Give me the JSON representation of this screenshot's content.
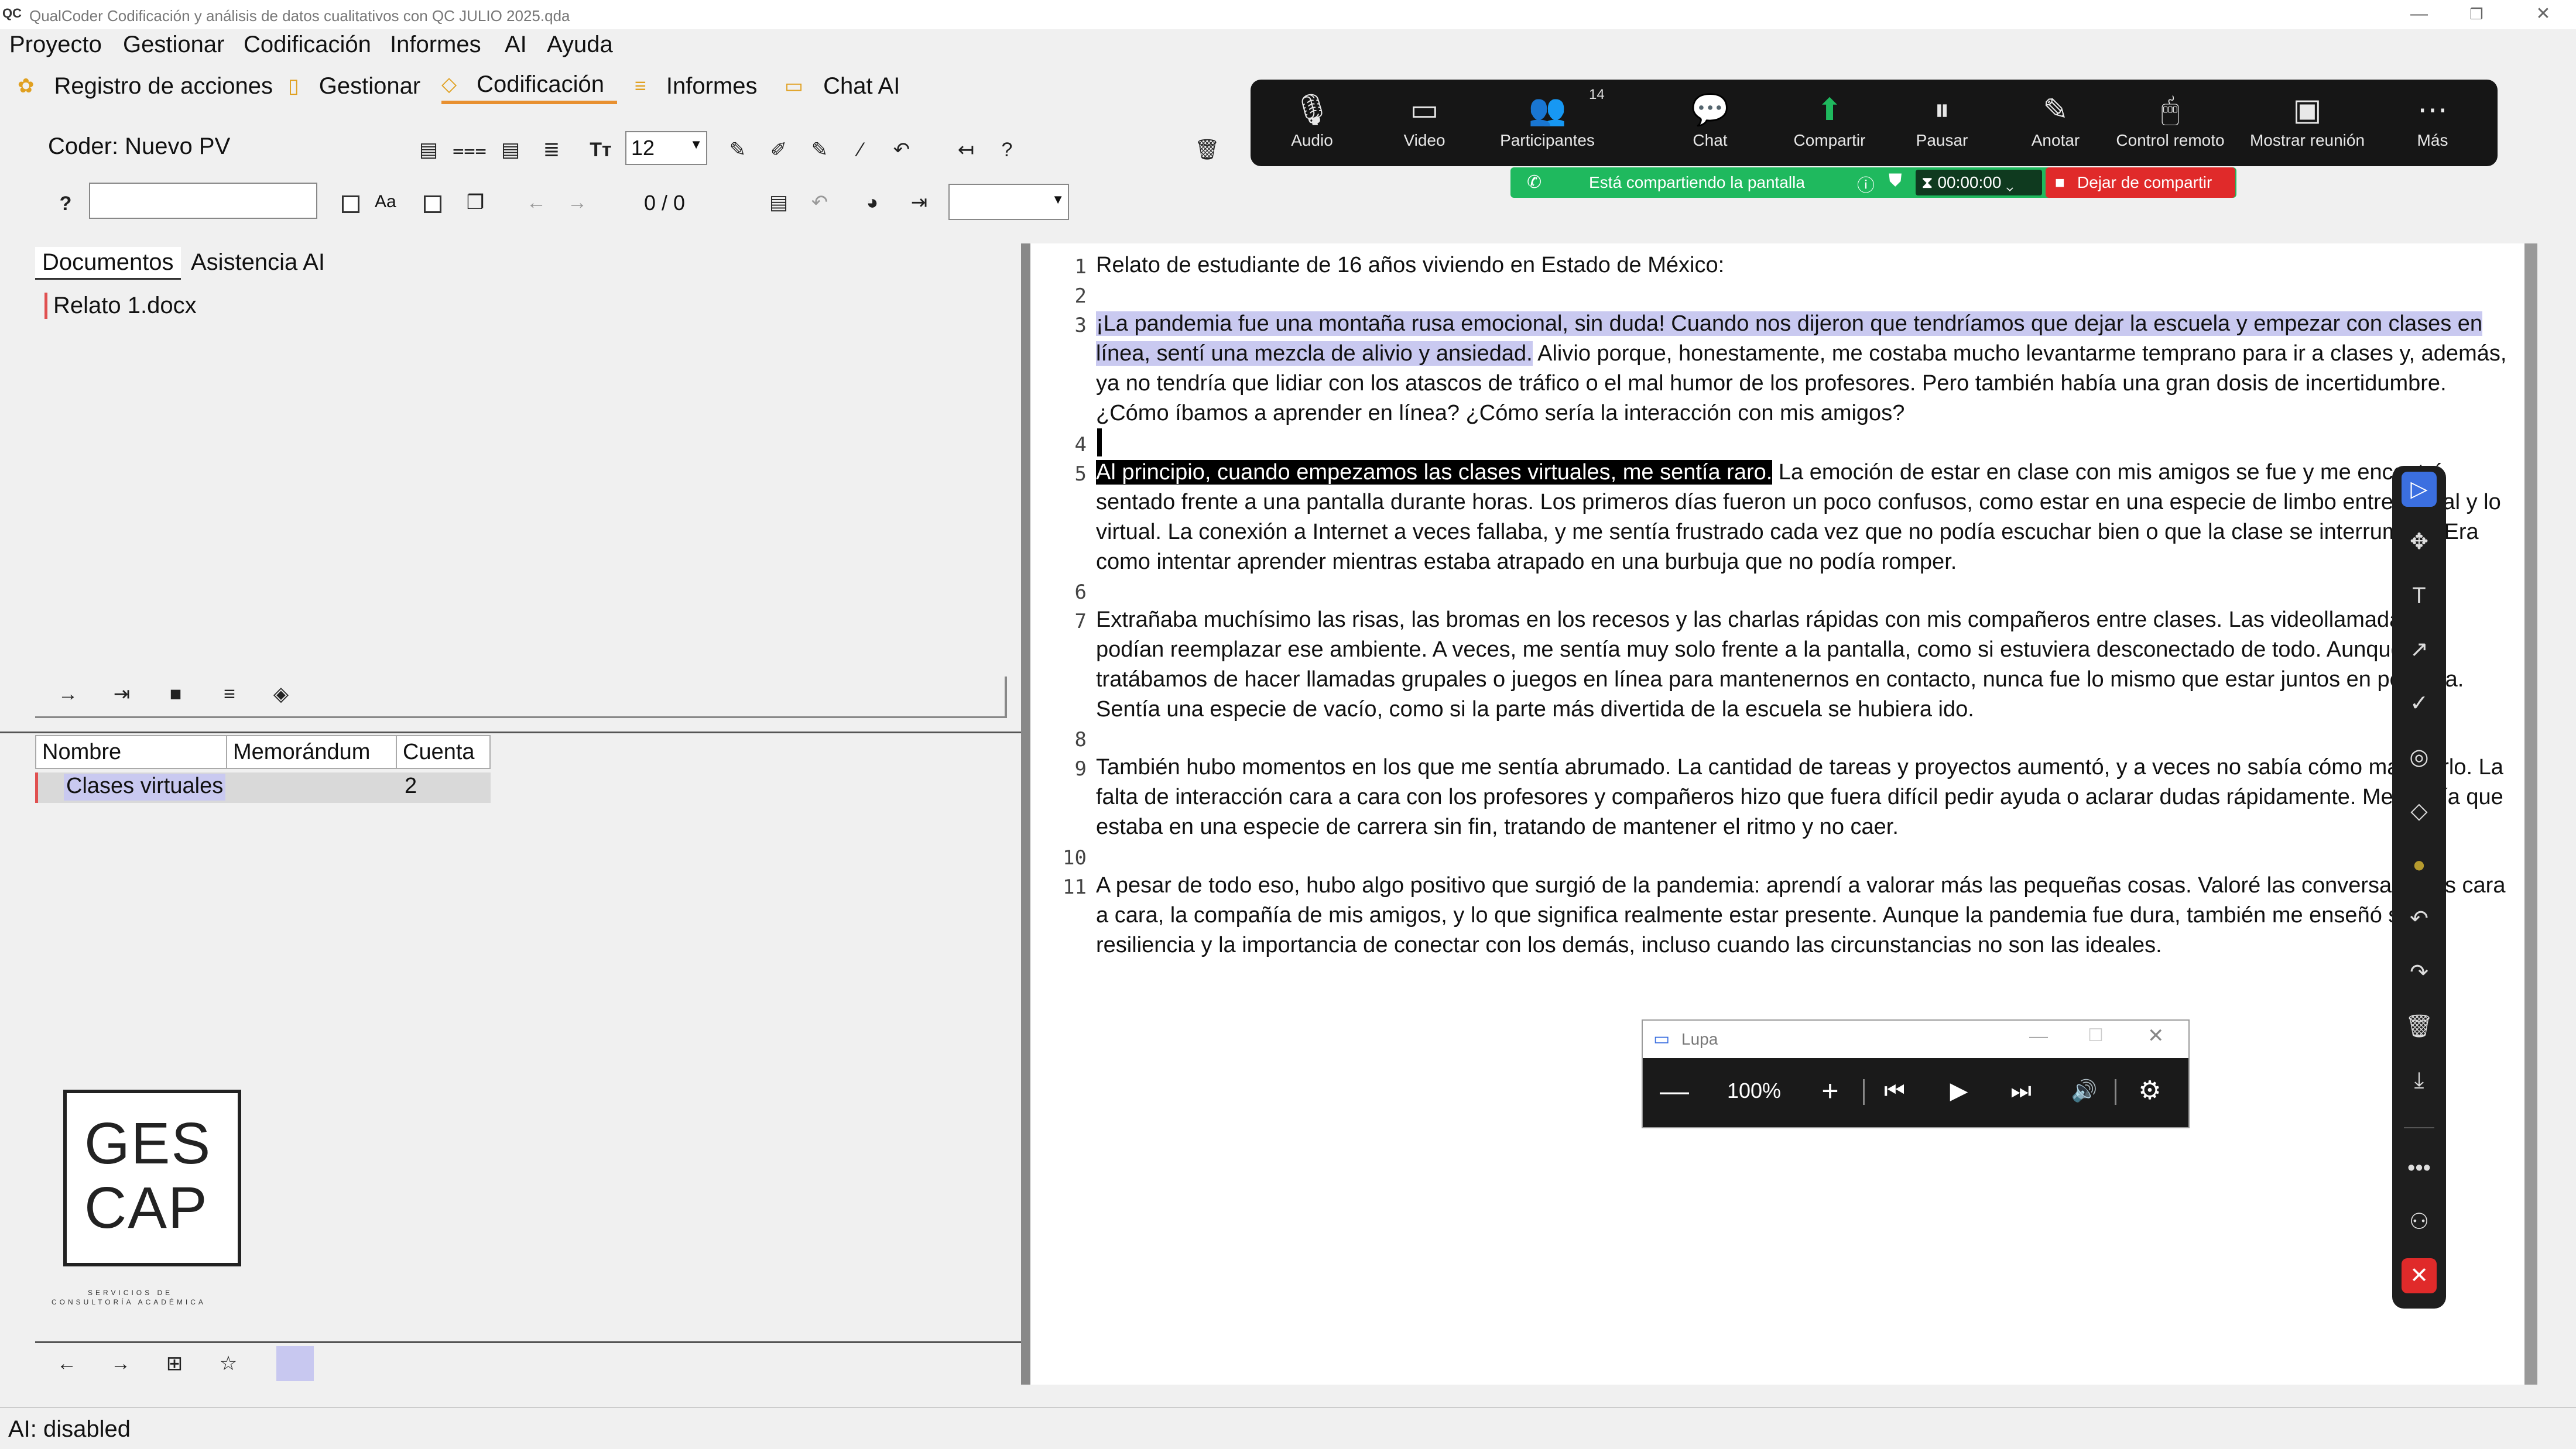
{
  "window": {
    "title": "QualCoder Codificación y análisis de datos cualitativos con QC JULIO 2025.qda",
    "app_icon": "QC",
    "minimize": "—",
    "restore": "❐",
    "close": "✕"
  },
  "menu": [
    "Proyecto",
    "Gestionar",
    "Codificación",
    "Informes",
    "AI",
    "Ayuda"
  ],
  "tabs": [
    {
      "label": "Registro de acciones"
    },
    {
      "label": "Gestionar"
    },
    {
      "label": "Codificación"
    },
    {
      "label": "Informes"
    },
    {
      "label": "Chat AI"
    }
  ],
  "toolbar": {
    "coder_label": "Coder: Nuevo PV",
    "font_size": "12",
    "help": "?",
    "search_placeholder": "",
    "aa_label": "Aa",
    "match_count": "0 / 0"
  },
  "left_panel": {
    "doc_tabs": [
      "Documentos",
      "Asistencia AI"
    ],
    "files": [
      "Relato 1.docx"
    ],
    "table_headers": [
      "Nombre",
      "Memorándum",
      "Cuenta"
    ],
    "codes": [
      {
        "name": "Clases virtuales",
        "memo": "",
        "count": "2",
        "color": "#c8c8f0"
      }
    ],
    "logo_line1": "GES",
    "logo_line2": "CAP",
    "logo_tagline1": "SERVICIOS DE",
    "logo_tagline2": "CONSULTORÍA ACADÉMICA"
  },
  "document": {
    "lines": [
      {
        "n": "1",
        "text": "Relato de estudiante de 16 años viviendo en Estado de México:"
      },
      {
        "n": "2",
        "text": ""
      },
      {
        "n": "3",
        "hl": "¡La pandemia fue una montaña rusa emocional, sin duda! Cuando nos dijeron que tendríamos que dejar la escuela y empezar con clases en línea, sentí una mezcla de alivio y ansiedad.",
        "text": " Alivio porque, honestamente, me costaba mucho levantarme temprano para ir a clases y, además, ya no tendría que lidiar con los atascos de tráfico o el mal humor de los profesores. Pero también había una gran dosis de incertidumbre. ¿Cómo íbamos a aprender en línea? ¿Cómo sería la interacción con mis amigos?"
      },
      {
        "n": "4",
        "text": ""
      },
      {
        "n": "5",
        "hl": "Al principio, cuando empezamos las clases virtuales, me sentía raro.",
        "text": " La emoción de estar en clase con mis amigos se fue y me encontré sentado frente a una pantalla durante horas. Los primeros días fueron un poco confusos, como estar en una especie de limbo entre lo real y lo virtual. La conexión a Internet a veces fallaba, y me sentía frustrado cada vez que no podía escuchar bien o que la clase se interrumpía. Era como intentar aprender mientras estaba atrapado en una burbuja que no podía romper."
      },
      {
        "n": "6",
        "text": ""
      },
      {
        "n": "7",
        "text": "Extrañaba muchísimo las risas, las bromas en los recesos y las charlas rápidas con mis compañeros entre clases. Las videollamadas no podían reemplazar ese ambiente. A veces, me sentía muy solo frente a la pantalla, como si estuviera desconectado de todo. Aunque tratábamos de hacer llamadas grupales o juegos en línea para mantenernos en contacto, nunca fue lo mismo que estar juntos en persona. Sentía una especie de vacío, como si la parte más divertida de la escuela se hubiera ido."
      },
      {
        "n": "8",
        "text": ""
      },
      {
        "n": "9",
        "text": "También hubo momentos en los que me sentía abrumado. La cantidad de tareas y proyectos aumentó, y a veces no sabía cómo manejarlo. La falta de interacción cara a cara con los profesores y compañeros hizo que fuera difícil pedir ayuda o aclarar dudas rápidamente. Me sentía que estaba en una especie de carrera sin fin, tratando de mantener el ritmo y no caer."
      },
      {
        "n": "10",
        "text": ""
      },
      {
        "n": "11",
        "text": "A pesar de todo eso, hubo algo positivo que surgió de la pandemia: aprendí a valorar más las pequeñas cosas. Valoré las conversaciones cara a cara, la compañía de mis amigos, y lo que significa realmente estar presente. Aunque la pandemia fue dura, también me enseñó sobre resiliencia y la importancia de conectar con los demás, incluso cuando las circunstancias no son las ideales."
      }
    ]
  },
  "zoom": {
    "items": [
      {
        "label": "Audio",
        "icon": "microphone-icon",
        "glyph": "🎙"
      },
      {
        "label": "Video",
        "icon": "camera-icon",
        "glyph": "▭"
      },
      {
        "label": "Participantes",
        "icon": "participants-icon",
        "glyph": "👥"
      },
      {
        "label": "Chat",
        "icon": "chat-icon",
        "glyph": "💬"
      },
      {
        "label": "Compartir",
        "icon": "share-icon",
        "glyph": "⬆"
      },
      {
        "label": "Pausar",
        "icon": "pause-icon",
        "glyph": "⏸"
      },
      {
        "label": "Anotar",
        "icon": "pencil-icon",
        "glyph": "✎"
      },
      {
        "label": "Control remoto",
        "icon": "mouse-icon",
        "glyph": "🖱"
      },
      {
        "label": "Mostrar reunión",
        "icon": "monitor-icon",
        "glyph": "▣"
      },
      {
        "label": "Más",
        "icon": "more-icon",
        "glyph": "⋯"
      }
    ],
    "participants_count": "14",
    "sharing_text": "Está compartiendo la pantalla",
    "timer": "00:00:00",
    "stop_sharing": "Dejar de compartir",
    "accent": "#1fb95e",
    "stop_color": "#e02a2a"
  },
  "magnifier": {
    "title": "Lupa",
    "zoom_level": "100%"
  },
  "status": {
    "text": "AI: disabled"
  }
}
